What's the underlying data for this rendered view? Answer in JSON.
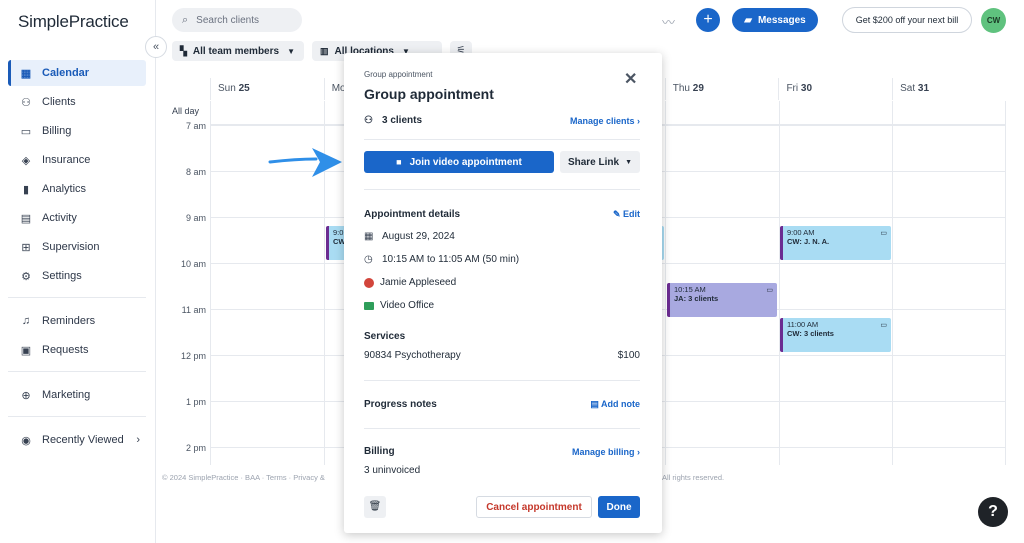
{
  "app": {
    "logo": "SimplePractice"
  },
  "sidebar": {
    "items": [
      {
        "label": "Calendar",
        "icon": "calendar-icon",
        "glyph": "▦"
      },
      {
        "label": "Clients",
        "icon": "clients-icon",
        "glyph": "👥"
      },
      {
        "label": "Billing",
        "icon": "billing-icon",
        "glyph": "▭"
      },
      {
        "label": "Insurance",
        "icon": "shield-icon",
        "glyph": "◈"
      },
      {
        "label": "Analytics",
        "icon": "analytics-icon",
        "glyph": "▮"
      },
      {
        "label": "Activity",
        "icon": "activity-icon",
        "glyph": "▤"
      },
      {
        "label": "Supervision",
        "icon": "supervision-icon",
        "glyph": "⊞"
      },
      {
        "label": "Settings",
        "icon": "gear-icon",
        "glyph": "⚙"
      }
    ],
    "items2": [
      {
        "label": "Reminders",
        "icon": "bell-icon",
        "glyph": "🔔"
      },
      {
        "label": "Requests",
        "icon": "requests-icon",
        "glyph": "▣"
      }
    ],
    "items3": [
      {
        "label": "Marketing",
        "icon": "globe-icon",
        "glyph": "🌐"
      },
      {
        "label": "Recently Viewed",
        "icon": "eye-icon",
        "glyph": "◉"
      }
    ],
    "collapse_glyph": "«"
  },
  "topbar": {
    "search_placeholder": "Search clients",
    "messages_label": "Messages",
    "promo_label": "Get $200 off your next bill",
    "avatar_initials": "CW",
    "plus_glyph": "+"
  },
  "filters": {
    "team": "All team members",
    "locations": "All locations"
  },
  "calendar": {
    "days": [
      {
        "name": "Sun",
        "num": "25"
      },
      {
        "name": "Mo",
        "num": ""
      },
      {
        "name": "",
        "num": ""
      },
      {
        "name": "",
        "num": ""
      },
      {
        "name": "Thu",
        "num": "29"
      },
      {
        "name": "Fri",
        "num": "30"
      },
      {
        "name": "Sat",
        "num": "31"
      }
    ],
    "all_day_label": "All day",
    "times": [
      "7 am",
      "8 am",
      "9 am",
      "10 am",
      "11 am",
      "12 pm",
      "1 pm",
      "2 pm"
    ],
    "events": [
      {
        "time": "9:0",
        "title": "CW",
        "color": "blue"
      },
      {
        "time": "10:15 AM",
        "title": "JA: 3 clients",
        "color": "purple"
      },
      {
        "time": "9:00 AM",
        "title": "CW: J. N. A.",
        "color": "blue"
      },
      {
        "time": "11:00 AM",
        "title": "CW: 3 clients",
        "color": "blue"
      }
    ]
  },
  "footer": {
    "left": "© 2024 SimplePractice · BAA · Terms · Privacy &",
    "right": "All rights reserved."
  },
  "popup": {
    "subtitle": "Group appointment",
    "title": "Group appointment",
    "clients_count": "3 clients",
    "manage_clients": "Manage clients",
    "join_label": "Join video appointment",
    "share_label": "Share Link",
    "details_title": "Appointment details",
    "edit_label": "Edit",
    "date": "August 29, 2024",
    "time": "10:15 AM to 11:05 AM (50 min)",
    "clinician": "Jamie Appleseed",
    "location": "Video Office",
    "services_title": "Services",
    "service_name": "90834 Psychotherapy",
    "service_price": "$100",
    "progress_title": "Progress notes",
    "add_note": "Add note",
    "billing_title": "Billing",
    "manage_billing": "Manage billing",
    "billing_status": "3 uninvoiced",
    "cancel_label": "Cancel appointment",
    "done_label": "Done"
  },
  "colors": {
    "accent": "#1a66c9",
    "event_blue": "#a9dcf3",
    "event_purple": "#a8a9e0",
    "event_border": "#6b2c91",
    "danger": "#c5382b",
    "arrow": "#2f8fe8"
  },
  "help_glyph": "?"
}
